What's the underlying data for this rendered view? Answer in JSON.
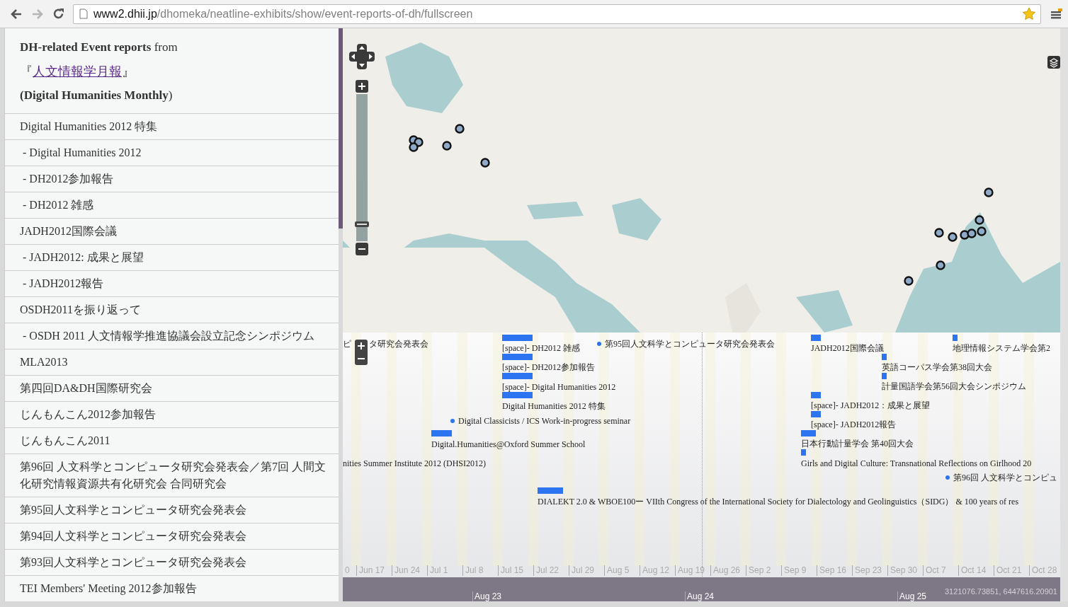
{
  "browser": {
    "url": {
      "host": "www2.dhii.jp",
      "path": "/dhomeka/neatline-exhibits/show/event-reports-of-dh/fullscreen"
    }
  },
  "sidebar": {
    "heading": {
      "line_1": "**DH-related Event reports** from",
      "open_bracket": "『",
      "link": "人文情報学月報",
      "close_bracket": "』",
      "line_3": "**(Digital Humanities Monthly**)"
    },
    "items": [
      {
        "label": "Digital Humanities 2012 特集",
        "children": [
          {
            "label": "- Digital Humanities 2012"
          },
          {
            "label": "- DH2012参加報告"
          },
          {
            "label": "- DH2012 雑感"
          }
        ]
      },
      {
        "label": "JADH2012国際会議",
        "children": [
          {
            "label": "- JADH2012: 成果と展望"
          },
          {
            "label": "- JADH2012報告"
          }
        ]
      },
      {
        "label": "OSDH2011を振り返って",
        "children": [
          {
            "label": "- OSDH 2011 人文情報学推進協議会設立記念シンポジウム"
          }
        ]
      },
      {
        "label": "MLA2013"
      },
      {
        "label": "第四回DA&DH国際研究会"
      },
      {
        "label": "じんもんこん2012参加報告"
      },
      {
        "label": "じんもんこん2011"
      },
      {
        "label": "第96回 人文科学とコンピュータ研究会発表会／第7回 人間文化研究情報資源共有化研究会 合同研究会"
      },
      {
        "label": "第95回人文科学とコンピュータ研究会発表会"
      },
      {
        "label": "第94回人文科学とコンピュータ研究会発表会"
      },
      {
        "label": "第93回人文科学とコンピュータ研究会発表会"
      },
      {
        "label": "TEI Members' Meeting 2012参加報告"
      }
    ]
  },
  "map": {
    "zoom": {
      "level": 0.1
    }
  },
  "timeline": {
    "events": [
      {
        "kind": "plain",
        "label": "ピ"
      },
      {
        "kind": "plain",
        "label": "タ研究会発表会"
      },
      {
        "kind": "bar",
        "label": "[space]- DH2012 雑感"
      },
      {
        "kind": "bar",
        "label": "[space]- DH2012参加報告"
      },
      {
        "kind": "bar",
        "label": "[space]- Digital Humanities 2012"
      },
      {
        "kind": "bar",
        "label": "Digital Humanities 2012 特集"
      },
      {
        "kind": "dot",
        "label": "第95回人文科学とコンピュータ研究会発表会"
      },
      {
        "kind": "dot",
        "label": "Digital Classicists / ICS Work-in-progress seminar"
      },
      {
        "kind": "bar",
        "label": "Digital.Humanities@Oxford Summer School"
      },
      {
        "kind": "plain",
        "label": "nities Summer Institute 2012 (DHSI2012)"
      },
      {
        "kind": "bar",
        "label": "DIALEKT 2.0 & WBOE100ー VIIth Congress of the International Society for Dialectology and Geolinguistics（SIDG） & 100 years of res"
      },
      {
        "kind": "bar",
        "label": "JADH2012国際会議"
      },
      {
        "kind": "bar",
        "label": "地理情報システム学会第2"
      },
      {
        "kind": "bar",
        "label": "英語コーパス学会第38回大会"
      },
      {
        "kind": "bar",
        "label": "計量国語学会第56回大会シンポジウム"
      },
      {
        "kind": "bar",
        "label": "[space]- JADH2012：成果と展望"
      },
      {
        "kind": "bar",
        "label": "[space]- JADH2012報告"
      },
      {
        "kind": "bar",
        "label": "日本行動計量学会 第40回大会"
      },
      {
        "kind": "bar",
        "label": "Girls and Digital Culture: Transnational Reflections on Girlhood 20"
      },
      {
        "kind": "dot",
        "label": "第96回 人文科学とコンピュ"
      }
    ],
    "ticks": [
      "0",
      "Jun 17",
      "Jun 24",
      "Jul 1",
      "Jul 8",
      "Jul 15",
      "Jul 22",
      "Jul 29",
      "Aug 5",
      "Aug 12",
      "Aug 19",
      "Aug 26",
      "Sep 2",
      "Sep 9",
      "Sep 16",
      "Sep 23",
      "Sep 30",
      "Oct 7",
      "Oct 14",
      "Oct 21",
      "Oct 28"
    ],
    "band_labels": [
      "Aug 23",
      "Aug 24",
      "Aug 25"
    ],
    "coordinates": "3121076.73851, 6447616.20901"
  }
}
